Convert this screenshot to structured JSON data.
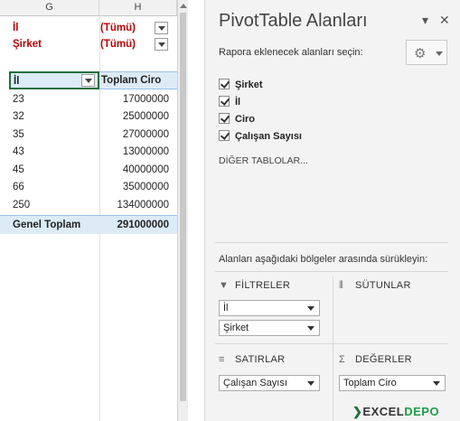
{
  "sheet": {
    "col_g": "G",
    "col_h": "H",
    "filters": [
      {
        "label": "İl",
        "value": "(Tümü)"
      },
      {
        "label": "Şirket",
        "value": "(Tümü)"
      }
    ],
    "pivot_header": {
      "row_label": "İl",
      "value_label": "Toplam Ciro"
    },
    "rows": [
      {
        "il": "23",
        "ciro": "17000000"
      },
      {
        "il": "32",
        "ciro": "25000000"
      },
      {
        "il": "35",
        "ciro": "27000000"
      },
      {
        "il": "43",
        "ciro": "13000000"
      },
      {
        "il": "45",
        "ciro": "40000000"
      },
      {
        "il": "66",
        "ciro": "35000000"
      },
      {
        "il": "250",
        "ciro": "134000000"
      }
    ],
    "total": {
      "label": "Genel Toplam",
      "value": "291000000"
    }
  },
  "pane": {
    "title": "PivotTable Alanları",
    "dropdown_glyph": "▾",
    "close_glyph": "✕",
    "choose_label": "Rapora eklenecek alanları seçin:",
    "fields": [
      {
        "label": "Şirket",
        "checked": true
      },
      {
        "label": "İl",
        "checked": true
      },
      {
        "label": "Ciro",
        "checked": true
      },
      {
        "label": "Çalışan Sayısı",
        "checked": true
      }
    ],
    "other_tables": "DİĞER TABLOLAR...",
    "drag_label": "Alanları aşağıdaki bölgeler arasında sürükleyin:",
    "areas": {
      "filters": {
        "title": "FİLTRELER",
        "icon": "funnel-icon",
        "items": [
          "İl",
          "Şirket"
        ]
      },
      "columns": {
        "title": "SÜTUNLAR",
        "icon": "columns-icon",
        "items": []
      },
      "rows": {
        "title": "SATIRLAR",
        "icon": "rows-icon",
        "items": [
          "Çalışan Sayısı"
        ]
      },
      "values": {
        "title": "DEĞERLER",
        "icon": "sigma-icon",
        "items": [
          "Toplam Ciro"
        ]
      }
    }
  },
  "watermark": {
    "text_a": "EXCEL",
    "text_b": "DEPO"
  },
  "colors": {
    "accent": "#217346",
    "pivot_fill": "#ddebf7",
    "filter_red": "#c00000"
  }
}
